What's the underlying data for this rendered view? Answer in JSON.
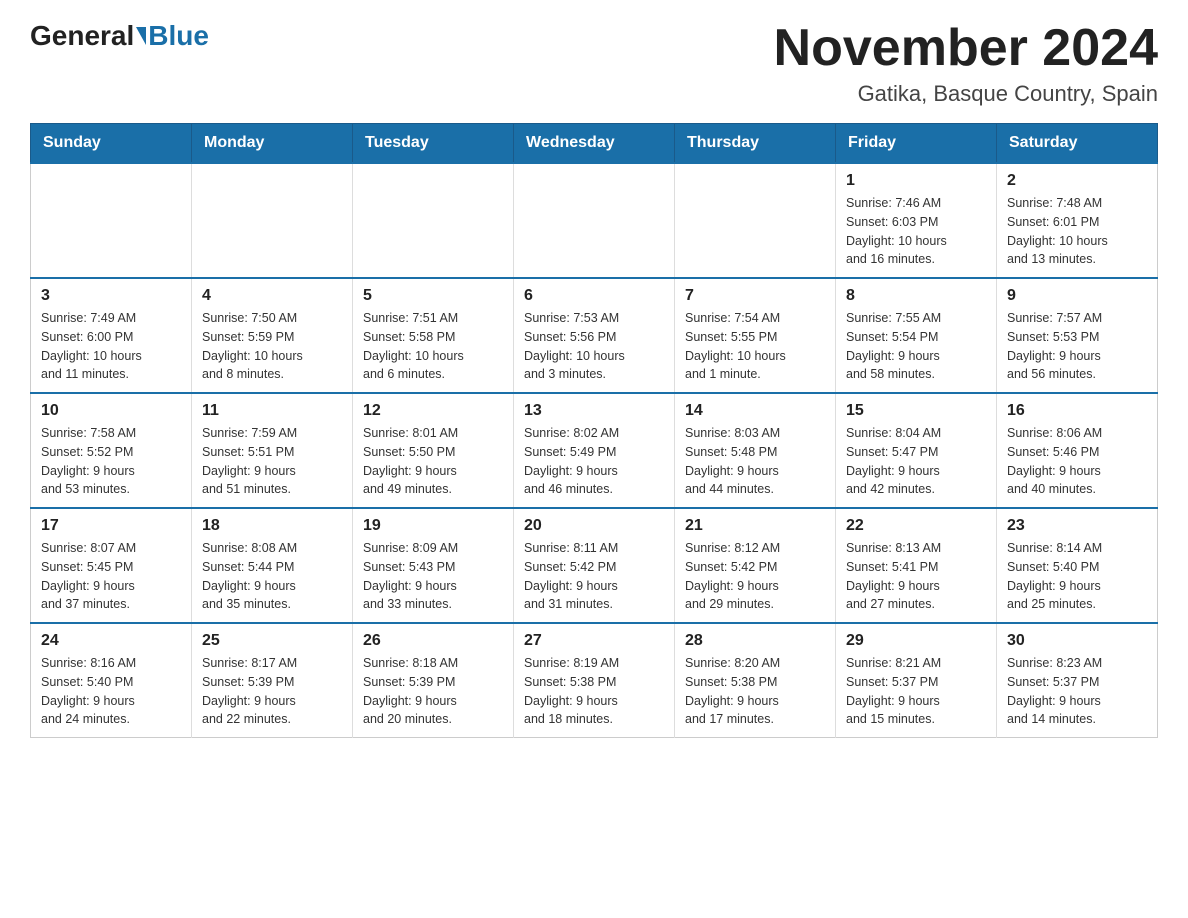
{
  "logo": {
    "text_general": "General",
    "text_blue": "Blue"
  },
  "title": "November 2024",
  "subtitle": "Gatika, Basque Country, Spain",
  "days_of_week": [
    "Sunday",
    "Monday",
    "Tuesday",
    "Wednesday",
    "Thursday",
    "Friday",
    "Saturday"
  ],
  "weeks": [
    [
      {
        "day": "",
        "info": ""
      },
      {
        "day": "",
        "info": ""
      },
      {
        "day": "",
        "info": ""
      },
      {
        "day": "",
        "info": ""
      },
      {
        "day": "",
        "info": ""
      },
      {
        "day": "1",
        "info": "Sunrise: 7:46 AM\nSunset: 6:03 PM\nDaylight: 10 hours\nand 16 minutes."
      },
      {
        "day": "2",
        "info": "Sunrise: 7:48 AM\nSunset: 6:01 PM\nDaylight: 10 hours\nand 13 minutes."
      }
    ],
    [
      {
        "day": "3",
        "info": "Sunrise: 7:49 AM\nSunset: 6:00 PM\nDaylight: 10 hours\nand 11 minutes."
      },
      {
        "day": "4",
        "info": "Sunrise: 7:50 AM\nSunset: 5:59 PM\nDaylight: 10 hours\nand 8 minutes."
      },
      {
        "day": "5",
        "info": "Sunrise: 7:51 AM\nSunset: 5:58 PM\nDaylight: 10 hours\nand 6 minutes."
      },
      {
        "day": "6",
        "info": "Sunrise: 7:53 AM\nSunset: 5:56 PM\nDaylight: 10 hours\nand 3 minutes."
      },
      {
        "day": "7",
        "info": "Sunrise: 7:54 AM\nSunset: 5:55 PM\nDaylight: 10 hours\nand 1 minute."
      },
      {
        "day": "8",
        "info": "Sunrise: 7:55 AM\nSunset: 5:54 PM\nDaylight: 9 hours\nand 58 minutes."
      },
      {
        "day": "9",
        "info": "Sunrise: 7:57 AM\nSunset: 5:53 PM\nDaylight: 9 hours\nand 56 minutes."
      }
    ],
    [
      {
        "day": "10",
        "info": "Sunrise: 7:58 AM\nSunset: 5:52 PM\nDaylight: 9 hours\nand 53 minutes."
      },
      {
        "day": "11",
        "info": "Sunrise: 7:59 AM\nSunset: 5:51 PM\nDaylight: 9 hours\nand 51 minutes."
      },
      {
        "day": "12",
        "info": "Sunrise: 8:01 AM\nSunset: 5:50 PM\nDaylight: 9 hours\nand 49 minutes."
      },
      {
        "day": "13",
        "info": "Sunrise: 8:02 AM\nSunset: 5:49 PM\nDaylight: 9 hours\nand 46 minutes."
      },
      {
        "day": "14",
        "info": "Sunrise: 8:03 AM\nSunset: 5:48 PM\nDaylight: 9 hours\nand 44 minutes."
      },
      {
        "day": "15",
        "info": "Sunrise: 8:04 AM\nSunset: 5:47 PM\nDaylight: 9 hours\nand 42 minutes."
      },
      {
        "day": "16",
        "info": "Sunrise: 8:06 AM\nSunset: 5:46 PM\nDaylight: 9 hours\nand 40 minutes."
      }
    ],
    [
      {
        "day": "17",
        "info": "Sunrise: 8:07 AM\nSunset: 5:45 PM\nDaylight: 9 hours\nand 37 minutes."
      },
      {
        "day": "18",
        "info": "Sunrise: 8:08 AM\nSunset: 5:44 PM\nDaylight: 9 hours\nand 35 minutes."
      },
      {
        "day": "19",
        "info": "Sunrise: 8:09 AM\nSunset: 5:43 PM\nDaylight: 9 hours\nand 33 minutes."
      },
      {
        "day": "20",
        "info": "Sunrise: 8:11 AM\nSunset: 5:42 PM\nDaylight: 9 hours\nand 31 minutes."
      },
      {
        "day": "21",
        "info": "Sunrise: 8:12 AM\nSunset: 5:42 PM\nDaylight: 9 hours\nand 29 minutes."
      },
      {
        "day": "22",
        "info": "Sunrise: 8:13 AM\nSunset: 5:41 PM\nDaylight: 9 hours\nand 27 minutes."
      },
      {
        "day": "23",
        "info": "Sunrise: 8:14 AM\nSunset: 5:40 PM\nDaylight: 9 hours\nand 25 minutes."
      }
    ],
    [
      {
        "day": "24",
        "info": "Sunrise: 8:16 AM\nSunset: 5:40 PM\nDaylight: 9 hours\nand 24 minutes."
      },
      {
        "day": "25",
        "info": "Sunrise: 8:17 AM\nSunset: 5:39 PM\nDaylight: 9 hours\nand 22 minutes."
      },
      {
        "day": "26",
        "info": "Sunrise: 8:18 AM\nSunset: 5:39 PM\nDaylight: 9 hours\nand 20 minutes."
      },
      {
        "day": "27",
        "info": "Sunrise: 8:19 AM\nSunset: 5:38 PM\nDaylight: 9 hours\nand 18 minutes."
      },
      {
        "day": "28",
        "info": "Sunrise: 8:20 AM\nSunset: 5:38 PM\nDaylight: 9 hours\nand 17 minutes."
      },
      {
        "day": "29",
        "info": "Sunrise: 8:21 AM\nSunset: 5:37 PM\nDaylight: 9 hours\nand 15 minutes."
      },
      {
        "day": "30",
        "info": "Sunrise: 8:23 AM\nSunset: 5:37 PM\nDaylight: 9 hours\nand 14 minutes."
      }
    ]
  ]
}
